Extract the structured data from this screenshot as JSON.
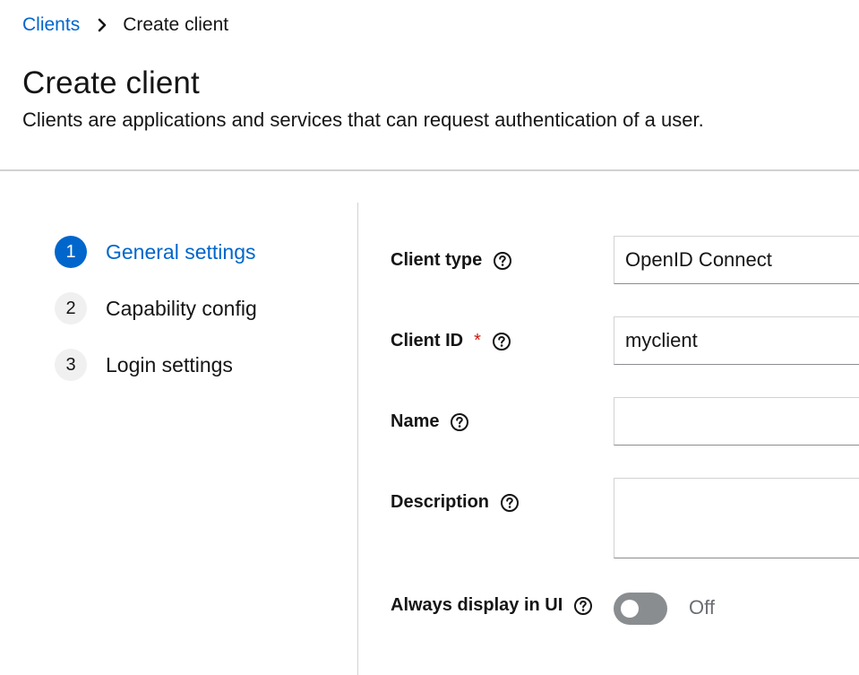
{
  "breadcrumb": {
    "parent": "Clients",
    "current": "Create client"
  },
  "header": {
    "title": "Create client",
    "description": "Clients are applications and services that can request authentication of a user."
  },
  "wizard": {
    "steps": [
      {
        "number": "1",
        "label": "General settings",
        "active": true
      },
      {
        "number": "2",
        "label": "Capability config",
        "active": false
      },
      {
        "number": "3",
        "label": "Login settings",
        "active": false
      }
    ]
  },
  "form": {
    "client_type": {
      "label": "Client type",
      "value": "OpenID Connect"
    },
    "client_id": {
      "label": "Client ID",
      "required_mark": "*",
      "value": "myclient"
    },
    "name": {
      "label": "Name",
      "value": ""
    },
    "description": {
      "label": "Description",
      "value": ""
    },
    "always_display": {
      "label": "Always display in UI",
      "state_text": "Off",
      "on": false
    }
  },
  "colors": {
    "link": "#0066cc",
    "active_step": "#0066cc",
    "required": "#c9190b",
    "toggle_off": "#8a8d90"
  },
  "icons": {
    "breadcrumb_separator": "chevron-right-icon",
    "help": "help-circle-icon"
  }
}
